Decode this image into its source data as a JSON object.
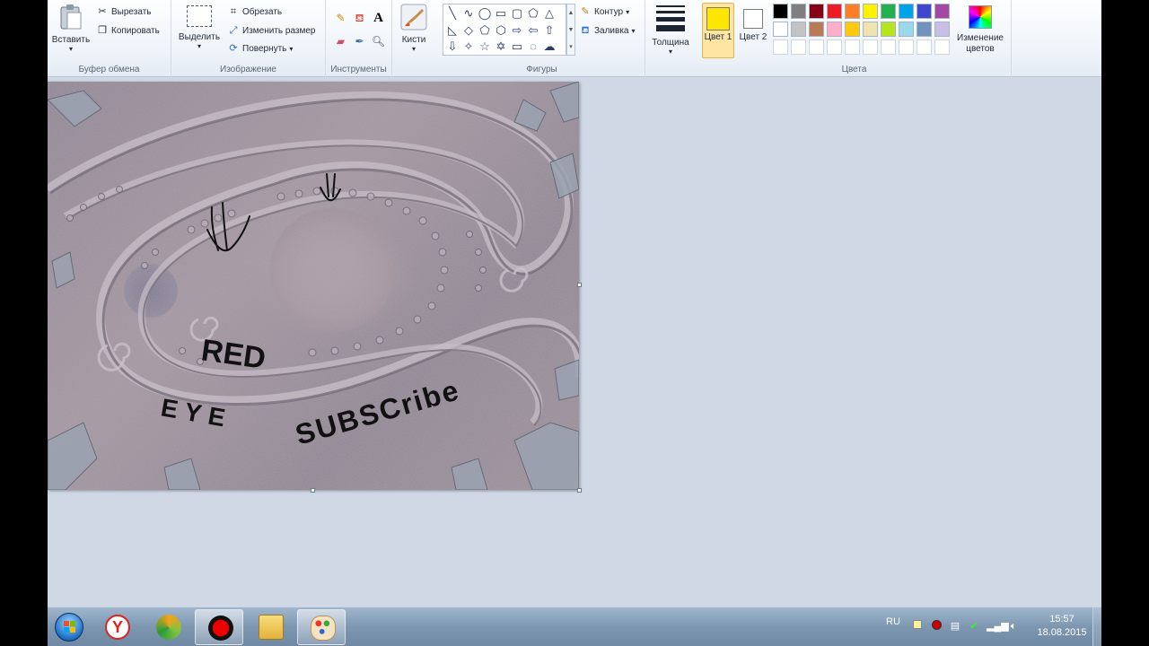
{
  "ribbon": {
    "clipboard": {
      "group_label": "Буфер обмена",
      "paste_label": "Вставить",
      "cut_label": "Вырезать",
      "copy_label": "Копировать"
    },
    "image": {
      "group_label": "Изображение",
      "select_label": "Выделить",
      "crop_label": "Обрезать",
      "resize_label": "Изменить размер",
      "rotate_label": "Повернуть"
    },
    "tools": {
      "group_label": "Инструменты",
      "brushes_label": "Кисти"
    },
    "shapes": {
      "group_label": "Фигуры",
      "outline_label": "Контур",
      "fill_label": "Заливка"
    },
    "size": {
      "label": "Толщина"
    },
    "colors": {
      "group_label": "Цвета",
      "color1_label": "Цвет 1",
      "color2_label": "Цвет 2",
      "color1_value": "#ffe600",
      "color2_value": "#ffffff",
      "edit_colors_label": "Изменение цветов",
      "palette_row1": [
        "#000000",
        "#7f7f7f",
        "#880015",
        "#ed1c24",
        "#ff7f27",
        "#fff200",
        "#22b14c",
        "#00a2e8",
        "#3f48cc",
        "#a349a4"
      ],
      "palette_row2": [
        "#ffffff",
        "#c3c3c3",
        "#b97a57",
        "#ffaec9",
        "#ffc90e",
        "#efe4b0",
        "#b5e61d",
        "#99d9ea",
        "#7092be",
        "#c8bfe7"
      ]
    }
  },
  "canvas": {
    "drawn_text_1": "RED",
    "drawn_text_2": "EYE",
    "drawn_text_3": "SUBSCribe"
  },
  "taskbar": {
    "language": "RU",
    "time": "15:57",
    "date": "18.08.2015"
  }
}
